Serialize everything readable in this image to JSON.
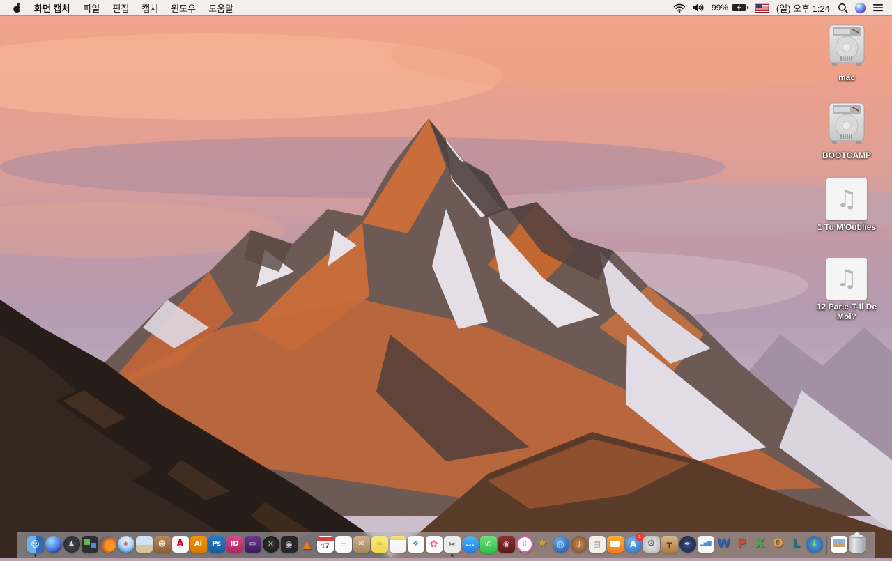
{
  "menu_bar": {
    "app_name": "화면 캡처",
    "menus": [
      "파일",
      "편집",
      "캡처",
      "윈도우",
      "도움말"
    ],
    "status": {
      "battery_percent": "99%",
      "clock": "(일) 오후 1:24"
    }
  },
  "desktop": {
    "audio_icon_glyph": "♫",
    "icons": [
      {
        "label": "mac",
        "type": "hard-drive"
      },
      {
        "label": "BOOTCAMP",
        "type": "hard-drive"
      },
      {
        "label": "1 Tu M'Oublies",
        "type": "audio-file"
      },
      {
        "label": "12 Parle-T-Il De Moi?",
        "type": "audio-file"
      }
    ]
  },
  "dock": {
    "items": [
      {
        "name": "finder",
        "active": true,
        "bg": "linear-gradient(90deg,#6cb2ee 50%,#2f6cb8 50%)",
        "glyph": "☺",
        "fg": "#ffffff",
        "size": 12
      },
      {
        "name": "siri",
        "round": true,
        "bg": "radial-gradient(circle at 35% 30%,#9be0f7,#4a7be0 55%,#16215c 90%)"
      },
      {
        "name": "launchpad",
        "round": true,
        "bg": "radial-gradient(circle,#4a4a52,#1e1e24)",
        "glyph": "▲",
        "fg": "#d8d8e0",
        "size": 9
      },
      {
        "name": "mission-control",
        "kind": "tiles"
      },
      {
        "name": "firefox",
        "round": true,
        "bg": "radial-gradient(circle at 62% 58%,#f79528 32%,#e86a10 46%,#2a5a9a 78%)"
      },
      {
        "name": "safari",
        "round": true,
        "bg": "radial-gradient(circle at 50% 35%,#f2f8fc,#b8d8f0 45%,#3f8ad8 82%)",
        "glyph": "◈",
        "fg": "#d04848",
        "size": 10
      },
      {
        "name": "preview",
        "bg": "linear-gradient(#cfe3f2 55%,#d8c49a 55%)"
      },
      {
        "name": "contacts",
        "bg": "linear-gradient(#b98a5a,#8a5f3a)",
        "glyph": "☻",
        "fg": "#f5ead8",
        "size": 11
      },
      {
        "name": "acrobat-reader",
        "bg": "#f8f8f8",
        "glyph": "A",
        "fg": "#d0021b",
        "size": 13,
        "bold": true
      },
      {
        "name": "illustrator",
        "bg": "linear-gradient(#f0940a,#d87a00)",
        "glyph": "Ai",
        "fg": "#ffffff",
        "size": 10,
        "bold": true
      },
      {
        "name": "photoshop",
        "bg": "linear-gradient(#2a7cc8,#1a5a9a)",
        "glyph": "Ps",
        "fg": "#ffffff",
        "size": 10,
        "bold": true
      },
      {
        "name": "indesign",
        "bg": "linear-gradient(#d84a8a,#a82a62)",
        "glyph": "ID",
        "fg": "#ffffff",
        "size": 10,
        "bold": true
      },
      {
        "name": "toast",
        "bg": "linear-gradient(#6a3a8a,#3a1a5a)",
        "glyph": "▭",
        "fg": "#e8e0f0",
        "size": 10
      },
      {
        "name": "xilisoft-converter",
        "round": true,
        "bg": "radial-gradient(circle,#3a3a3a,#0f0f0f)",
        "glyph": "✕",
        "fg": "#9ed63a",
        "size": 11,
        "bold": true
      },
      {
        "name": "disc-utility",
        "bg": "#26262b",
        "glyph": "◉",
        "fg": "#c8c8d0",
        "size": 12
      },
      {
        "name": "vlc",
        "glyph": "▲",
        "fg": "#e87722",
        "size": 16,
        "bold": true,
        "shadow": true
      },
      {
        "name": "calendar",
        "kind": "calendar",
        "day": "17"
      },
      {
        "name": "reminders",
        "bg": "#fbfbfb",
        "glyph": "☰",
        "fg": "#a8a8a8",
        "size": 11
      },
      {
        "name": "archive-utility",
        "bg": "linear-gradient(#cdb089,#a8875f)",
        "glyph": "✉",
        "fg": "#f2ecdc",
        "size": 10
      },
      {
        "name": "stickies",
        "bg": "linear-gradient(#f8e97a,#f0d84a)",
        "glyph": "≡",
        "fg": "#c9b53a",
        "size": 12
      },
      {
        "name": "notes",
        "kind": "notes"
      },
      {
        "name": "document-app",
        "bg": "#ffffff",
        "glyph": "❖",
        "fg": "#4a90d9",
        "size": 10
      },
      {
        "name": "photos",
        "bg": "#ffffff",
        "glyph": "✿",
        "fg": "#e8609a",
        "size": 14
      },
      {
        "name": "grab",
        "active": true,
        "bg": "#ececec",
        "glyph": "✂",
        "fg": "#444444",
        "size": 12
      },
      {
        "name": "messages",
        "round": true,
        "bg": "linear-gradient(#4ab8f8,#1f7de8)",
        "glyph": "…",
        "fg": "#ffffff",
        "size": 13,
        "bold": true
      },
      {
        "name": "facetime",
        "bg": "linear-gradient(#6fe07a,#2fc04a)",
        "glyph": "✆",
        "fg": "#ffffff",
        "size": 11
      },
      {
        "name": "photo-booth",
        "bg": "linear-gradient(#8a3030,#5a1a1a)",
        "glyph": "◉",
        "fg": "#f0c8c8",
        "size": 11
      },
      {
        "name": "itunes",
        "round": true,
        "bg": "radial-gradient(circle,#ffffff 56%,#ef5aa7 60%,#b85ad8 100%)",
        "glyph": "♫",
        "fg": "#e84a9a",
        "size": 10
      },
      {
        "name": "imovie",
        "glyph": "★",
        "fg": "#caa42c",
        "size": 17,
        "shadow": true
      },
      {
        "name": "dvd-ripper",
        "round": true,
        "bg": "radial-gradient(circle at 40% 35%,#6ab0f0,#1a4a90)",
        "glyph": "◎",
        "fg": "#d8e8f8",
        "size": 12
      },
      {
        "name": "garageband",
        "round": true,
        "bg": "radial-gradient(circle,#c89058,#6a4420)",
        "glyph": "♩",
        "fg": "#f5e8d0",
        "size": 12
      },
      {
        "name": "newsletter-app",
        "bg": "#f2efe8",
        "glyph": "▤",
        "fg": "#8a8a8a",
        "size": 11
      },
      {
        "name": "ibooks",
        "kind": "book",
        "bg": "linear-gradient(#ffb03a,#f07a18)"
      },
      {
        "name": "app-store",
        "round": true,
        "bg": "radial-gradient(circle at 40% 30%,#6cb4f0,#2a70c8)",
        "glyph": "A",
        "fg": "#ffffff",
        "size": 12,
        "bold": true,
        "badge": "1"
      },
      {
        "name": "system-preferences",
        "bg": "radial-gradient(#ececec,#b4b4b8)",
        "glyph": "⚙",
        "fg": "#555555",
        "size": 13
      },
      {
        "name": "keynote",
        "bg": "linear-gradient(#d8b890,#b07840)",
        "glyph": "┳",
        "fg": "#5a3a1a",
        "size": 13,
        "bold": true
      },
      {
        "name": "pages",
        "round": true,
        "bg": "radial-gradient(circle,#3a4e7e,#16203e)",
        "glyph": "✒",
        "fg": "#e8e8f0",
        "size": 11
      },
      {
        "name": "numbers",
        "bg": "#f8f8f8",
        "glyph": "▂▅▇",
        "fg": "#4a90d9",
        "size": 7
      },
      {
        "name": "word",
        "glyph": "W",
        "fg": "#2a5ca8",
        "size": 17,
        "bold": true,
        "shadow": true
      },
      {
        "name": "powerpoint",
        "glyph": "P",
        "fg": "#d24726",
        "size": 17,
        "bold": true,
        "shadow": true
      },
      {
        "name": "excel",
        "glyph": "X",
        "fg": "#3faa3f",
        "size": 17,
        "bold": true,
        "shadow": true
      },
      {
        "name": "outlook",
        "glyph": "O",
        "fg": "#f0a030",
        "size": 17,
        "bold": true,
        "shadow": true
      },
      {
        "name": "lync",
        "glyph": "L",
        "fg": "#00808c",
        "size": 17,
        "bold": true,
        "shadow": true
      },
      {
        "name": "downloader",
        "round": true,
        "bg": "radial-gradient(circle,#58a0e0,#1a5aa0)",
        "glyph": "↓",
        "fg": "#8ae03a",
        "size": 13,
        "bold": true
      },
      {
        "name": "separator",
        "kind": "separator"
      },
      {
        "name": "document-file",
        "kind": "docfile"
      },
      {
        "name": "trash",
        "kind": "trash"
      }
    ]
  }
}
